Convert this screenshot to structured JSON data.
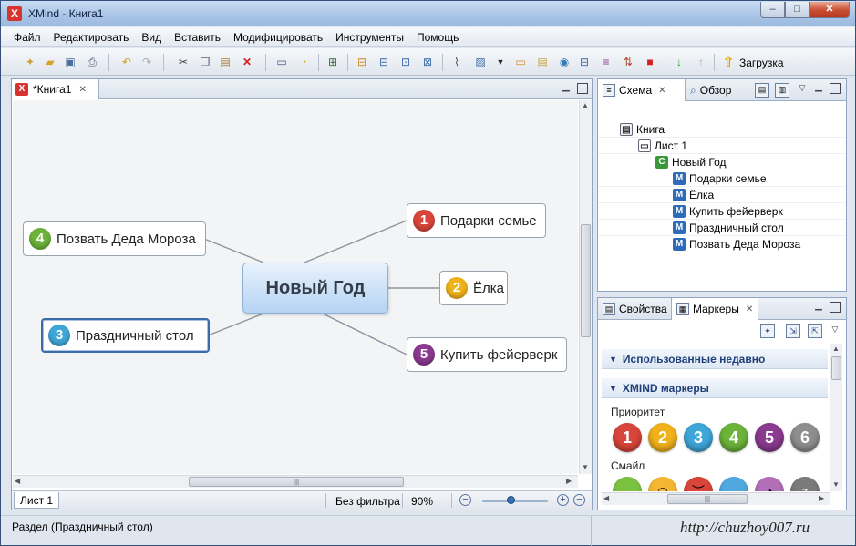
{
  "window": {
    "title": "XMind - Книга1",
    "app_icon": "X",
    "min": "–",
    "max": "□",
    "close": "✕"
  },
  "menu": [
    "Файл",
    "Редактировать",
    "Вид",
    "Вставить",
    "Модифицировать",
    "Инструменты",
    "Помощь"
  ],
  "toolbar": {
    "upload_label": "Загрузка"
  },
  "editor": {
    "tab_label": "*Книга1",
    "sheet_tab": "Лист 1",
    "filter": "Без фильтра",
    "zoom": "90%",
    "zoom_level": 0.45
  },
  "mindmap": {
    "central": "Новый Год",
    "topics": [
      {
        "label": "Подарки семье",
        "marker": "1",
        "color": "#d9453a"
      },
      {
        "label": "Ёлка",
        "marker": "2",
        "color": "#f0b21a"
      },
      {
        "label": "Праздничный стол",
        "marker": "3",
        "color": "#3ea6d8"
      },
      {
        "label": "Позвать Деда Мороза",
        "marker": "4",
        "color": "#6cb33a"
      },
      {
        "label": "Купить фейерверк",
        "marker": "5",
        "color": "#8a3a8f"
      }
    ]
  },
  "outline": {
    "tab_label": "Схема",
    "overview_label": "Обзор",
    "tree": [
      {
        "label": "Книга",
        "icon": "book-icon",
        "glyph": "▤"
      },
      {
        "label": "Лист 1",
        "icon": "sheet-icon",
        "glyph": "▭"
      },
      {
        "label": "Новый Год",
        "icon": "central-topic-icon",
        "glyph": "C"
      },
      {
        "label": "Подарки семье",
        "icon": "main-topic-icon",
        "glyph": "M"
      },
      {
        "label": "Ёлка",
        "icon": "main-topic-icon",
        "glyph": "M"
      },
      {
        "label": "Купить фейерверк",
        "icon": "main-topic-icon",
        "glyph": "M"
      },
      {
        "label": "Праздничный стол",
        "icon": "main-topic-icon",
        "glyph": "M"
      },
      {
        "label": "Позвать Деда Мороза",
        "icon": "main-topic-icon",
        "glyph": "M"
      }
    ]
  },
  "markers": {
    "properties_tab": "Свойства",
    "markers_tab": "Маркеры",
    "recent_section": "Использованные недавно",
    "xmind_section": "XMIND маркеры",
    "priority_label": "Приоритет",
    "smiley_label": "Смайл",
    "priority": [
      {
        "n": "1",
        "color": "#d9453a"
      },
      {
        "n": "2",
        "color": "#f0b21a"
      },
      {
        "n": "3",
        "color": "#3ea6d8"
      },
      {
        "n": "4",
        "color": "#6cb33a"
      },
      {
        "n": "5",
        "color": "#8a3a8f"
      },
      {
        "n": "6",
        "color": "#8e8e8e"
      }
    ],
    "smileys": [
      {
        "face": "◡",
        "color": "#7cc242"
      },
      {
        "face": "◠",
        "color": "#f5b731"
      },
      {
        "face": "︶",
        "color": "#d9453a"
      },
      {
        "face": "︵",
        "color": "#4fa9df"
      },
      {
        "face": "◕",
        "color": "#b26fb7"
      },
      {
        "face": "z",
        "color": "#7a7a7a"
      }
    ]
  },
  "status": {
    "text": "Раздел (Праздничный стол)"
  },
  "watermark": "http://chuzhoy007.ru"
}
